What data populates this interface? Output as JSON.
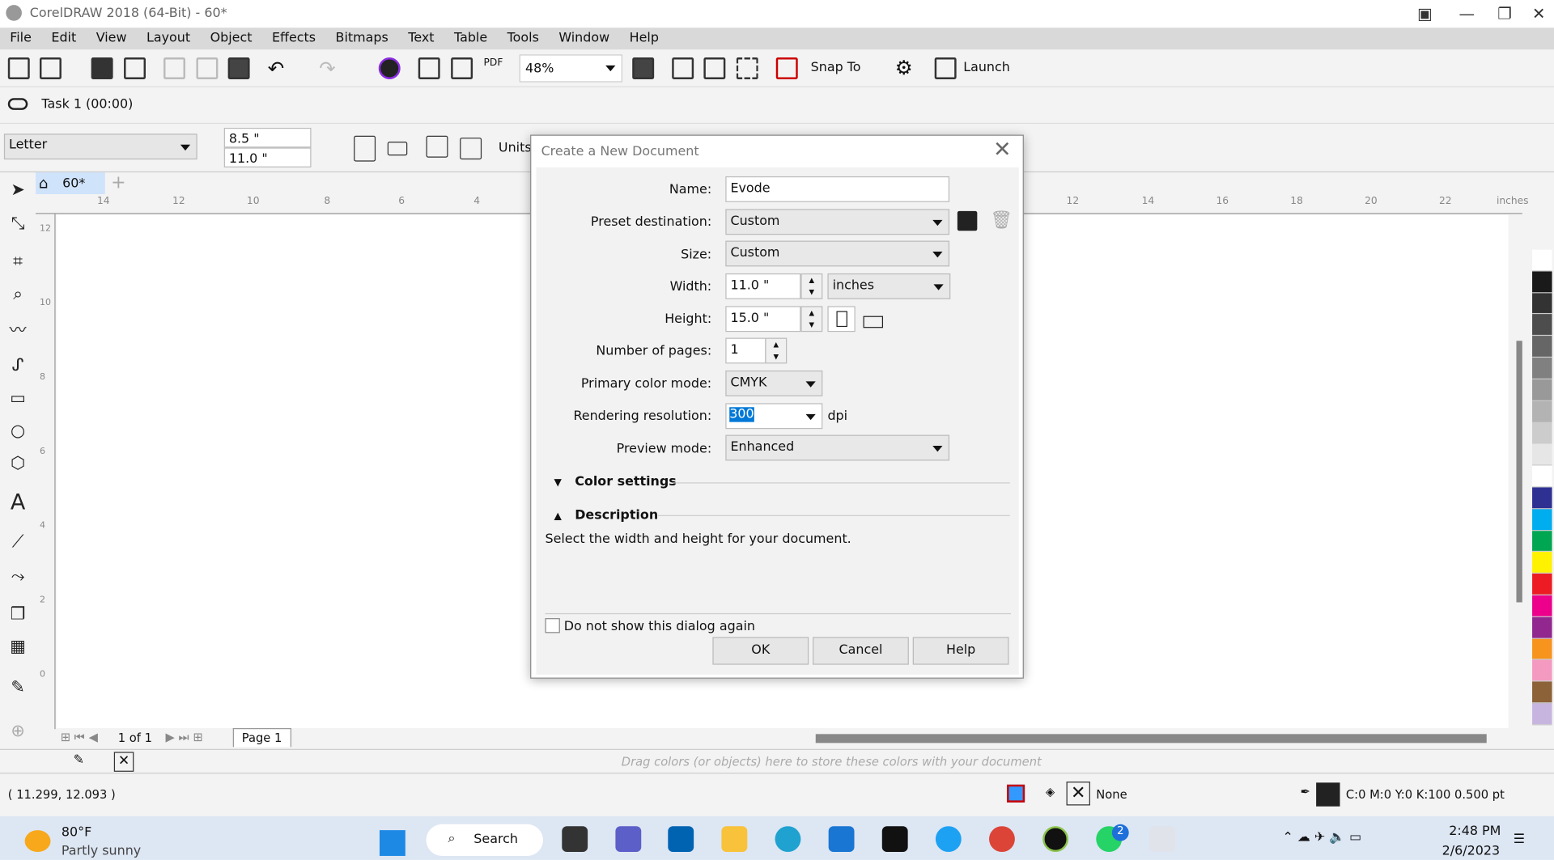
{
  "window": {
    "title": "CorelDRAW 2018 (64-Bit) - 60*"
  },
  "menu": [
    "File",
    "Edit",
    "View",
    "Layout",
    "Object",
    "Effects",
    "Bitmaps",
    "Text",
    "Table",
    "Tools",
    "Window",
    "Help"
  ],
  "toolbar": {
    "zoom": "48%",
    "snap_to": "Snap To",
    "launch": "Launch",
    "pdf": "PDF"
  },
  "task": {
    "label": "Task 1 (00:00)"
  },
  "property_bar": {
    "page_size": "Letter",
    "width": "8.5 \"",
    "height": "11.0 \"",
    "units_label": "Units:"
  },
  "doc_tab": {
    "label": "60*"
  },
  "ruler": {
    "ticks": [
      "14",
      "12",
      "10",
      "8",
      "6",
      "4",
      "12",
      "14",
      "16",
      "18",
      "20",
      "22"
    ],
    "unit": "inches",
    "vticks": [
      "12",
      "10",
      "8",
      "6",
      "4",
      "2",
      "0"
    ]
  },
  "dialog": {
    "title": "Create a New Document",
    "name_label": "Name:",
    "name_value": "Evode",
    "preset_label": "Preset destination:",
    "preset_value": "Custom",
    "size_label": "Size:",
    "size_value": "Custom",
    "width_label": "Width:",
    "width_value": "11.0 \"",
    "units_value": "inches",
    "height_label": "Height:",
    "height_value": "15.0 \"",
    "pages_label": "Number of pages:",
    "pages_value": "1",
    "color_mode_label": "Primary color mode:",
    "color_mode_value": "CMYK",
    "resolution_label": "Rendering resolution:",
    "resolution_value": "300",
    "resolution_unit": "dpi",
    "preview_label": "Preview mode:",
    "preview_value": "Enhanced",
    "color_settings": "Color settings",
    "description": "Description",
    "description_text": "Select the width and height for your document.",
    "dont_show": "Do not show this dialog again",
    "ok": "OK",
    "cancel": "Cancel",
    "help": "Help"
  },
  "page_nav": {
    "position": "1 of 1",
    "page_tab": "Page 1"
  },
  "color_bar": {
    "hint": "Drag colors (or objects) here to store these colors with your document"
  },
  "palette": [
    "#ffffff",
    "#1a1a1a",
    "#333333",
    "#4d4d4d",
    "#666666",
    "#808080",
    "#999999",
    "#b3b3b3",
    "#cccccc",
    "#e6e6e6",
    "#ffffff",
    "#2e3192",
    "#00aeef",
    "#00a651",
    "#fff200",
    "#ed1c24",
    "#ec008c",
    "#92278f",
    "#f7941d",
    "#f49ac1",
    "#8c6239",
    "#c7b5e0"
  ],
  "status": {
    "coords": "( 11.299, 12.093 )",
    "fill": "None",
    "outline": "C:0 M:0 Y:0 K:100  0.500 pt"
  },
  "taskbar": {
    "temp": "80°F",
    "weather": "Partly sunny",
    "search": "Search",
    "time": "2:48 PM",
    "date": "2/6/2023",
    "badge": "2"
  }
}
